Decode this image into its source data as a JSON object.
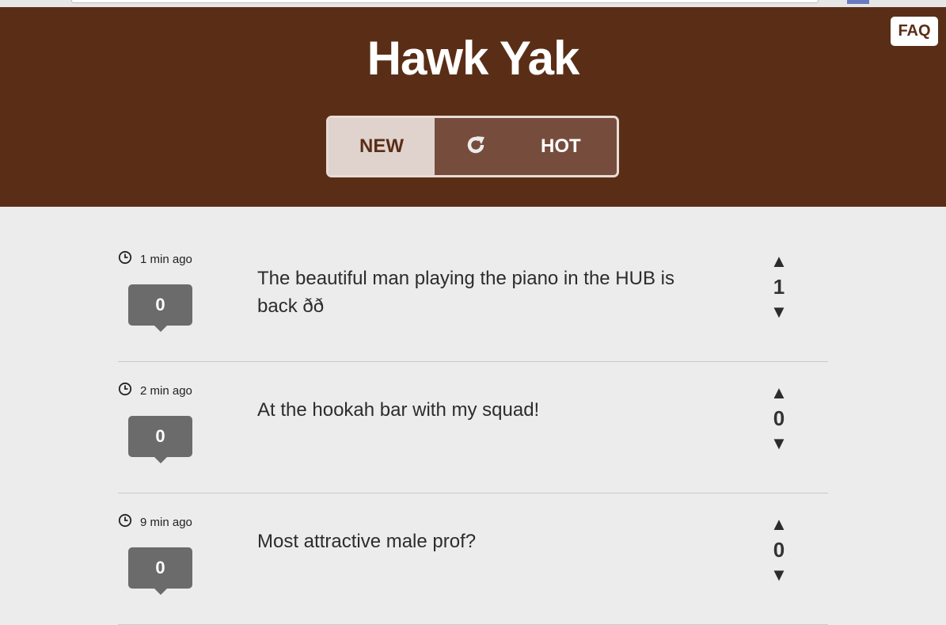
{
  "header": {
    "title": "Hawk Yak",
    "faq_label": "FAQ",
    "sort": {
      "new_label": "NEW",
      "hot_label": "HOT",
      "selected": "NEW"
    },
    "colors": {
      "header_bg": "#5a2e16",
      "tab_active_bg": "#e0d3ce",
      "tab_inactive_bg": "#764d3c"
    }
  },
  "icons": {
    "refresh": "refresh-icon",
    "clock": "clock-icon",
    "upvote": "upvote-arrow-icon",
    "downvote": "downvote-arrow-icon"
  },
  "posts": [
    {
      "time": "1 min ago",
      "comments": "0",
      "text": "The beautiful man playing the piano in the HUB is back ðð",
      "score": "1"
    },
    {
      "time": "2 min ago",
      "comments": "0",
      "text": "At the hookah bar with my squad!",
      "score": "0"
    },
    {
      "time": "9 min ago",
      "comments": "0",
      "text": "Most attractive male prof?",
      "score": "0"
    }
  ]
}
